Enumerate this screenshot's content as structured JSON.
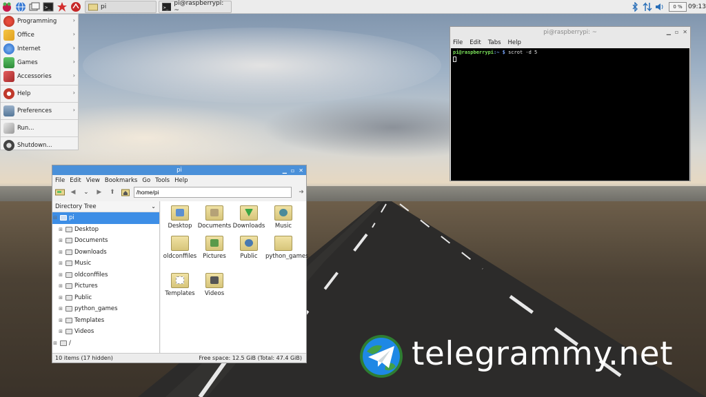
{
  "panel": {
    "launchers": [
      "raspberry-menu",
      "web-browser",
      "file-manager",
      "terminal",
      "mathematica",
      "wolfram"
    ],
    "tasks": [
      {
        "label": "pi",
        "icon": "folder-icon"
      },
      {
        "label": "pi@raspberrypi: ~",
        "icon": "terminal-icon"
      }
    ],
    "cpu": "0 %",
    "clock": "09:13"
  },
  "menu": {
    "items": [
      {
        "label": "Programming",
        "submenu": true,
        "color": "#c0392b"
      },
      {
        "label": "Office",
        "submenu": true,
        "color": "#e0a020"
      },
      {
        "label": "Internet",
        "submenu": true,
        "color": "#3a7bd5"
      },
      {
        "label": "Games",
        "submenu": true,
        "color": "#3aa544"
      },
      {
        "label": "Accessories",
        "submenu": true,
        "color": "#d04040"
      },
      {
        "label": "Help",
        "submenu": true,
        "color": "#c0392b"
      },
      {
        "label": "Preferences",
        "submenu": true,
        "color": "#557799"
      },
      {
        "label": "Run...",
        "submenu": false,
        "color": "#777777"
      },
      {
        "label": "Shutdown...",
        "submenu": false,
        "color": "#444444"
      }
    ]
  },
  "terminal": {
    "title": "pi@raspberrypi: ~",
    "menus": [
      "File",
      "Edit",
      "Tabs",
      "Help"
    ],
    "prompt_user": "pi@raspberrypi",
    "prompt_path": ":~ $",
    "command": "scrot -d 5"
  },
  "filemanager": {
    "title": "pi",
    "menus": [
      "File",
      "Edit",
      "View",
      "Bookmarks",
      "Go",
      "Tools",
      "Help"
    ],
    "path": "/home/pi",
    "tree_header": "Directory Tree",
    "tree": [
      {
        "label": "pi",
        "expander": "⊟",
        "level": 0,
        "selected": true
      },
      {
        "label": "Desktop",
        "expander": "⊞",
        "level": 1
      },
      {
        "label": "Documents",
        "expander": "⊞",
        "level": 1
      },
      {
        "label": "Downloads",
        "expander": "⊞",
        "level": 1
      },
      {
        "label": "Music",
        "expander": "⊞",
        "level": 1
      },
      {
        "label": "oldconffiles",
        "expander": "⊞",
        "level": 1
      },
      {
        "label": "Pictures",
        "expander": "⊞",
        "level": 1
      },
      {
        "label": "Public",
        "expander": "⊞",
        "level": 1
      },
      {
        "label": "python_games",
        "expander": "⊞",
        "level": 1
      },
      {
        "label": "Templates",
        "expander": "⊞",
        "level": 1
      },
      {
        "label": "Videos",
        "expander": "⊞",
        "level": 1
      },
      {
        "label": "/",
        "expander": "⊞",
        "level": 0
      }
    ],
    "files": [
      {
        "label": "Desktop",
        "mark": "#5c8fd0"
      },
      {
        "label": "Documents",
        "mark": "#b5a277"
      },
      {
        "label": "Downloads",
        "mark": "#3aa544"
      },
      {
        "label": "Music",
        "mark": "#4a8a9a"
      },
      {
        "label": "oldconffiles",
        "mark": ""
      },
      {
        "label": "Pictures",
        "mark": "#5a9a4a"
      },
      {
        "label": "Public",
        "mark": "#4a7ab0"
      },
      {
        "label": "python_games",
        "mark": ""
      },
      {
        "label": "Templates",
        "mark": "#b8b8b8"
      },
      {
        "label": "Videos",
        "mark": "#555555"
      }
    ],
    "status_items": "10 items (17 hidden)",
    "status_free": "Free space: 12.5 GiB (Total: 47.4 GiB)"
  },
  "watermark": {
    "text": "telegrammy.net"
  }
}
